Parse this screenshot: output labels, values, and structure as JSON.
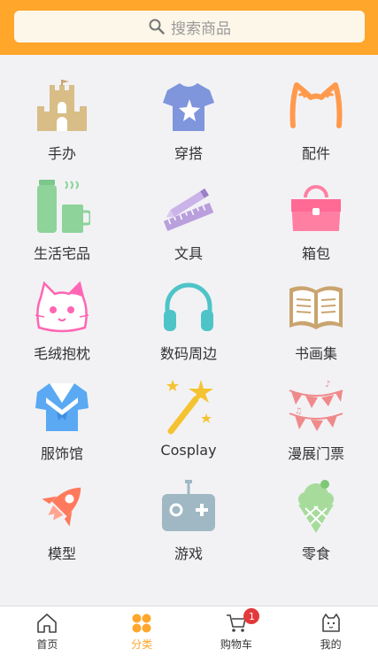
{
  "search": {
    "placeholder": "搜索商品",
    "icon": "search-icon"
  },
  "categories": [
    {
      "label": "手办",
      "icon": "castle-icon",
      "color": "#d8bd86"
    },
    {
      "label": "穿搭",
      "icon": "tshirt-icon",
      "color": "#7f95dc"
    },
    {
      "label": "配件",
      "icon": "cat-ears-icon",
      "color": "#ff9a4d"
    },
    {
      "label": "生活宅品",
      "icon": "thermos-cup-icon",
      "color": "#8ed39a"
    },
    {
      "label": "文具",
      "icon": "pencil-ruler-icon",
      "color": "#b99fdc"
    },
    {
      "label": "箱包",
      "icon": "handbag-icon",
      "color": "#ff7fa3"
    },
    {
      "label": "毛绒抱枕",
      "icon": "cat-face-icon",
      "color": "#ff66b3"
    },
    {
      "label": "数码周边",
      "icon": "headphones-icon",
      "color": "#4fc4c8"
    },
    {
      "label": "书画集",
      "icon": "open-book-icon",
      "color": "#c9a46e"
    },
    {
      "label": "服饰馆",
      "icon": "sailor-uniform-icon",
      "color": "#5aa9f2"
    },
    {
      "label": "Cosplay",
      "icon": "magic-wand-icon",
      "color": "#f5c332"
    },
    {
      "label": "漫展门票",
      "icon": "bunting-flags-icon",
      "color": "#f08a8a"
    },
    {
      "label": "模型",
      "icon": "rocket-icon",
      "color": "#ff7a5c"
    },
    {
      "label": "游戏",
      "icon": "gamepad-icon",
      "color": "#9fb8c4"
    },
    {
      "label": "零食",
      "icon": "ice-cream-icon",
      "color": "#a6db9c"
    }
  ],
  "tabbar": {
    "items": [
      {
        "label": "首页",
        "icon": "home-icon"
      },
      {
        "label": "分类",
        "icon": "category-icon"
      },
      {
        "label": "购物车",
        "icon": "cart-icon",
        "badge": "1"
      },
      {
        "label": "我的",
        "icon": "profile-icon"
      }
    ],
    "active_color": "#ffa62b"
  },
  "colors": {
    "header": "#ffa62b",
    "background": "#f2f2f5",
    "badge": "#e4393c"
  }
}
